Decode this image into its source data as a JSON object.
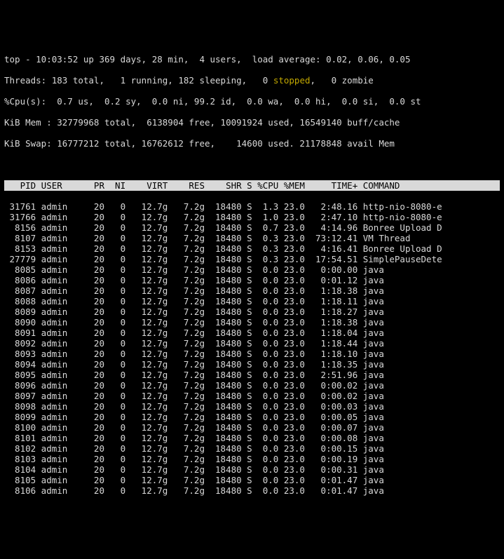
{
  "summary": {
    "line1_a": "top - 10:03:52 up 369 days, 28 min,  4 users,  load average: 0.02, 0.06, 0.05",
    "line2_a": "Threads: 183 total,   1 running, 182 sleeping,   0 ",
    "line2_stopped_label": "stopped",
    "line2_b": ",   0 zombie",
    "line3": "%Cpu(s):  0.7 us,  0.2 sy,  0.0 ni, 99.2 id,  0.0 wa,  0.0 hi,  0.0 si,  0.0 st",
    "line4": "KiB Mem : 32779968 total,  6138904 free, 10091924 used, 16549140 buff/cache",
    "line5": "KiB Swap: 16777212 total, 16762612 free,    14600 used. 21178848 avail Mem "
  },
  "header": {
    "PID": "PID",
    "USER": "USER",
    "PR": "PR",
    "NI": "NI",
    "VIRT": "VIRT",
    "RES": "RES",
    "SHR": "SHR",
    "S": "S",
    "CPU": "%CPU",
    "MEM": "%MEM",
    "TIME": "TIME+",
    "CMD": "COMMAND"
  },
  "rows": [
    {
      "pid": "31761",
      "user": "admin",
      "pr": "20",
      "ni": "0",
      "virt": "12.7g",
      "res": "7.2g",
      "shr": "18480",
      "s": "S",
      "cpu": "1.3",
      "mem": "23.0",
      "time": "2:48.16",
      "cmd": "http-nio-8080-e"
    },
    {
      "pid": "31766",
      "user": "admin",
      "pr": "20",
      "ni": "0",
      "virt": "12.7g",
      "res": "7.2g",
      "shr": "18480",
      "s": "S",
      "cpu": "1.0",
      "mem": "23.0",
      "time": "2:47.10",
      "cmd": "http-nio-8080-e"
    },
    {
      "pid": "8156",
      "user": "admin",
      "pr": "20",
      "ni": "0",
      "virt": "12.7g",
      "res": "7.2g",
      "shr": "18480",
      "s": "S",
      "cpu": "0.7",
      "mem": "23.0",
      "time": "4:14.96",
      "cmd": "Bonree Upload D"
    },
    {
      "pid": "8107",
      "user": "admin",
      "pr": "20",
      "ni": "0",
      "virt": "12.7g",
      "res": "7.2g",
      "shr": "18480",
      "s": "S",
      "cpu": "0.3",
      "mem": "23.0",
      "time": "73:12.41",
      "cmd": "VM Thread"
    },
    {
      "pid": "8153",
      "user": "admin",
      "pr": "20",
      "ni": "0",
      "virt": "12.7g",
      "res": "7.2g",
      "shr": "18480",
      "s": "S",
      "cpu": "0.3",
      "mem": "23.0",
      "time": "4:16.41",
      "cmd": "Bonree Upload D"
    },
    {
      "pid": "27779",
      "user": "admin",
      "pr": "20",
      "ni": "0",
      "virt": "12.7g",
      "res": "7.2g",
      "shr": "18480",
      "s": "S",
      "cpu": "0.3",
      "mem": "23.0",
      "time": "17:54.51",
      "cmd": "SimplePauseDete"
    },
    {
      "pid": "8085",
      "user": "admin",
      "pr": "20",
      "ni": "0",
      "virt": "12.7g",
      "res": "7.2g",
      "shr": "18480",
      "s": "S",
      "cpu": "0.0",
      "mem": "23.0",
      "time": "0:00.00",
      "cmd": "java"
    },
    {
      "pid": "8086",
      "user": "admin",
      "pr": "20",
      "ni": "0",
      "virt": "12.7g",
      "res": "7.2g",
      "shr": "18480",
      "s": "S",
      "cpu": "0.0",
      "mem": "23.0",
      "time": "0:01.12",
      "cmd": "java"
    },
    {
      "pid": "8087",
      "user": "admin",
      "pr": "20",
      "ni": "0",
      "virt": "12.7g",
      "res": "7.2g",
      "shr": "18480",
      "s": "S",
      "cpu": "0.0",
      "mem": "23.0",
      "time": "1:18.38",
      "cmd": "java"
    },
    {
      "pid": "8088",
      "user": "admin",
      "pr": "20",
      "ni": "0",
      "virt": "12.7g",
      "res": "7.2g",
      "shr": "18480",
      "s": "S",
      "cpu": "0.0",
      "mem": "23.0",
      "time": "1:18.11",
      "cmd": "java"
    },
    {
      "pid": "8089",
      "user": "admin",
      "pr": "20",
      "ni": "0",
      "virt": "12.7g",
      "res": "7.2g",
      "shr": "18480",
      "s": "S",
      "cpu": "0.0",
      "mem": "23.0",
      "time": "1:18.27",
      "cmd": "java"
    },
    {
      "pid": "8090",
      "user": "admin",
      "pr": "20",
      "ni": "0",
      "virt": "12.7g",
      "res": "7.2g",
      "shr": "18480",
      "s": "S",
      "cpu": "0.0",
      "mem": "23.0",
      "time": "1:18.38",
      "cmd": "java"
    },
    {
      "pid": "8091",
      "user": "admin",
      "pr": "20",
      "ni": "0",
      "virt": "12.7g",
      "res": "7.2g",
      "shr": "18480",
      "s": "S",
      "cpu": "0.0",
      "mem": "23.0",
      "time": "1:18.04",
      "cmd": "java"
    },
    {
      "pid": "8092",
      "user": "admin",
      "pr": "20",
      "ni": "0",
      "virt": "12.7g",
      "res": "7.2g",
      "shr": "18480",
      "s": "S",
      "cpu": "0.0",
      "mem": "23.0",
      "time": "1:18.44",
      "cmd": "java"
    },
    {
      "pid": "8093",
      "user": "admin",
      "pr": "20",
      "ni": "0",
      "virt": "12.7g",
      "res": "7.2g",
      "shr": "18480",
      "s": "S",
      "cpu": "0.0",
      "mem": "23.0",
      "time": "1:18.10",
      "cmd": "java"
    },
    {
      "pid": "8094",
      "user": "admin",
      "pr": "20",
      "ni": "0",
      "virt": "12.7g",
      "res": "7.2g",
      "shr": "18480",
      "s": "S",
      "cpu": "0.0",
      "mem": "23.0",
      "time": "1:18.35",
      "cmd": "java"
    },
    {
      "pid": "8095",
      "user": "admin",
      "pr": "20",
      "ni": "0",
      "virt": "12.7g",
      "res": "7.2g",
      "shr": "18480",
      "s": "S",
      "cpu": "0.0",
      "mem": "23.0",
      "time": "2:51.96",
      "cmd": "java"
    },
    {
      "pid": "8096",
      "user": "admin",
      "pr": "20",
      "ni": "0",
      "virt": "12.7g",
      "res": "7.2g",
      "shr": "18480",
      "s": "S",
      "cpu": "0.0",
      "mem": "23.0",
      "time": "0:00.02",
      "cmd": "java"
    },
    {
      "pid": "8097",
      "user": "admin",
      "pr": "20",
      "ni": "0",
      "virt": "12.7g",
      "res": "7.2g",
      "shr": "18480",
      "s": "S",
      "cpu": "0.0",
      "mem": "23.0",
      "time": "0:00.02",
      "cmd": "java"
    },
    {
      "pid": "8098",
      "user": "admin",
      "pr": "20",
      "ni": "0",
      "virt": "12.7g",
      "res": "7.2g",
      "shr": "18480",
      "s": "S",
      "cpu": "0.0",
      "mem": "23.0",
      "time": "0:00.03",
      "cmd": "java"
    },
    {
      "pid": "8099",
      "user": "admin",
      "pr": "20",
      "ni": "0",
      "virt": "12.7g",
      "res": "7.2g",
      "shr": "18480",
      "s": "S",
      "cpu": "0.0",
      "mem": "23.0",
      "time": "0:00.05",
      "cmd": "java"
    },
    {
      "pid": "8100",
      "user": "admin",
      "pr": "20",
      "ni": "0",
      "virt": "12.7g",
      "res": "7.2g",
      "shr": "18480",
      "s": "S",
      "cpu": "0.0",
      "mem": "23.0",
      "time": "0:00.07",
      "cmd": "java"
    },
    {
      "pid": "8101",
      "user": "admin",
      "pr": "20",
      "ni": "0",
      "virt": "12.7g",
      "res": "7.2g",
      "shr": "18480",
      "s": "S",
      "cpu": "0.0",
      "mem": "23.0",
      "time": "0:00.08",
      "cmd": "java"
    },
    {
      "pid": "8102",
      "user": "admin",
      "pr": "20",
      "ni": "0",
      "virt": "12.7g",
      "res": "7.2g",
      "shr": "18480",
      "s": "S",
      "cpu": "0.0",
      "mem": "23.0",
      "time": "0:00.15",
      "cmd": "java"
    },
    {
      "pid": "8103",
      "user": "admin",
      "pr": "20",
      "ni": "0",
      "virt": "12.7g",
      "res": "7.2g",
      "shr": "18480",
      "s": "S",
      "cpu": "0.0",
      "mem": "23.0",
      "time": "0:00.19",
      "cmd": "java"
    },
    {
      "pid": "8104",
      "user": "admin",
      "pr": "20",
      "ni": "0",
      "virt": "12.7g",
      "res": "7.2g",
      "shr": "18480",
      "s": "S",
      "cpu": "0.0",
      "mem": "23.0",
      "time": "0:00.31",
      "cmd": "java"
    },
    {
      "pid": "8105",
      "user": "admin",
      "pr": "20",
      "ni": "0",
      "virt": "12.7g",
      "res": "7.2g",
      "shr": "18480",
      "s": "S",
      "cpu": "0.0",
      "mem": "23.0",
      "time": "0:01.47",
      "cmd": "java"
    },
    {
      "pid": "8106",
      "user": "admin",
      "pr": "20",
      "ni": "0",
      "virt": "12.7g",
      "res": "7.2g",
      "shr": "18480",
      "s": "S",
      "cpu": "0.0",
      "mem": "23.0",
      "time": "0:01.47",
      "cmd": "java"
    }
  ]
}
